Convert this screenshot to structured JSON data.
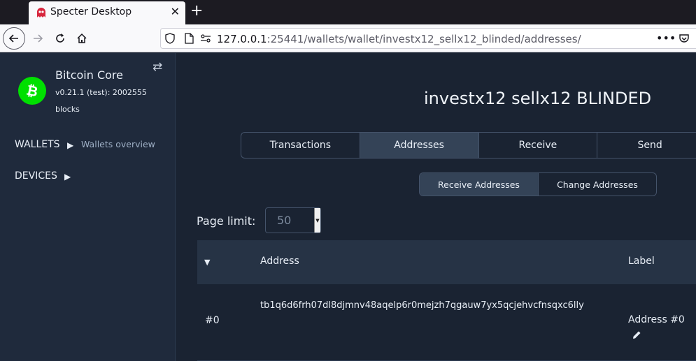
{
  "browser": {
    "tab_title": "Specter Desktop",
    "url_host": "127.0.0.1",
    "url_rest": ":25441/wallets/wallet/investx12_sellx12_blinded/addresses/"
  },
  "sidebar": {
    "node_name": "Bitcoin Core",
    "node_version": "v0.21.1 (test): 2002555",
    "node_blocks": "blocks",
    "wallets_label": "WALLETS",
    "wallets_sub": "Wallets overview",
    "devices_label": "DEVICES"
  },
  "main": {
    "wallet_title": "investx12 sellx12 BLINDED",
    "tabs": [
      {
        "label": "Transactions"
      },
      {
        "label": "Addresses"
      },
      {
        "label": "Receive"
      },
      {
        "label": "Send"
      }
    ],
    "subtabs": [
      {
        "label": "Receive Addresses"
      },
      {
        "label": "Change Addresses"
      }
    ],
    "page_limit_label": "Page limit:",
    "page_limit_value": "50",
    "table": {
      "headers": [
        "Address",
        "Label"
      ],
      "rows": [
        {
          "index": "#0",
          "address": "tb1q6d6frh07dl8djmnv48aqelp6r0mejzh7qgauw7yx5qcjehvcfnsqxc6lly",
          "label": "Address #0"
        }
      ]
    }
  },
  "colors": {
    "accent_active": "#344357",
    "bitcoin_green": "#00e000"
  },
  "icons": [
    "ghost-favicon-icon",
    "close-icon",
    "plus-icon",
    "back-arrow-icon",
    "forward-arrow-icon",
    "reload-icon",
    "home-icon",
    "shield-icon",
    "page-icon",
    "site-info-icon",
    "more-icon",
    "pocket-icon",
    "bitcoin-icon",
    "swap-icon",
    "triangle-right-icon",
    "sort-down-icon",
    "pencil-icon"
  ]
}
